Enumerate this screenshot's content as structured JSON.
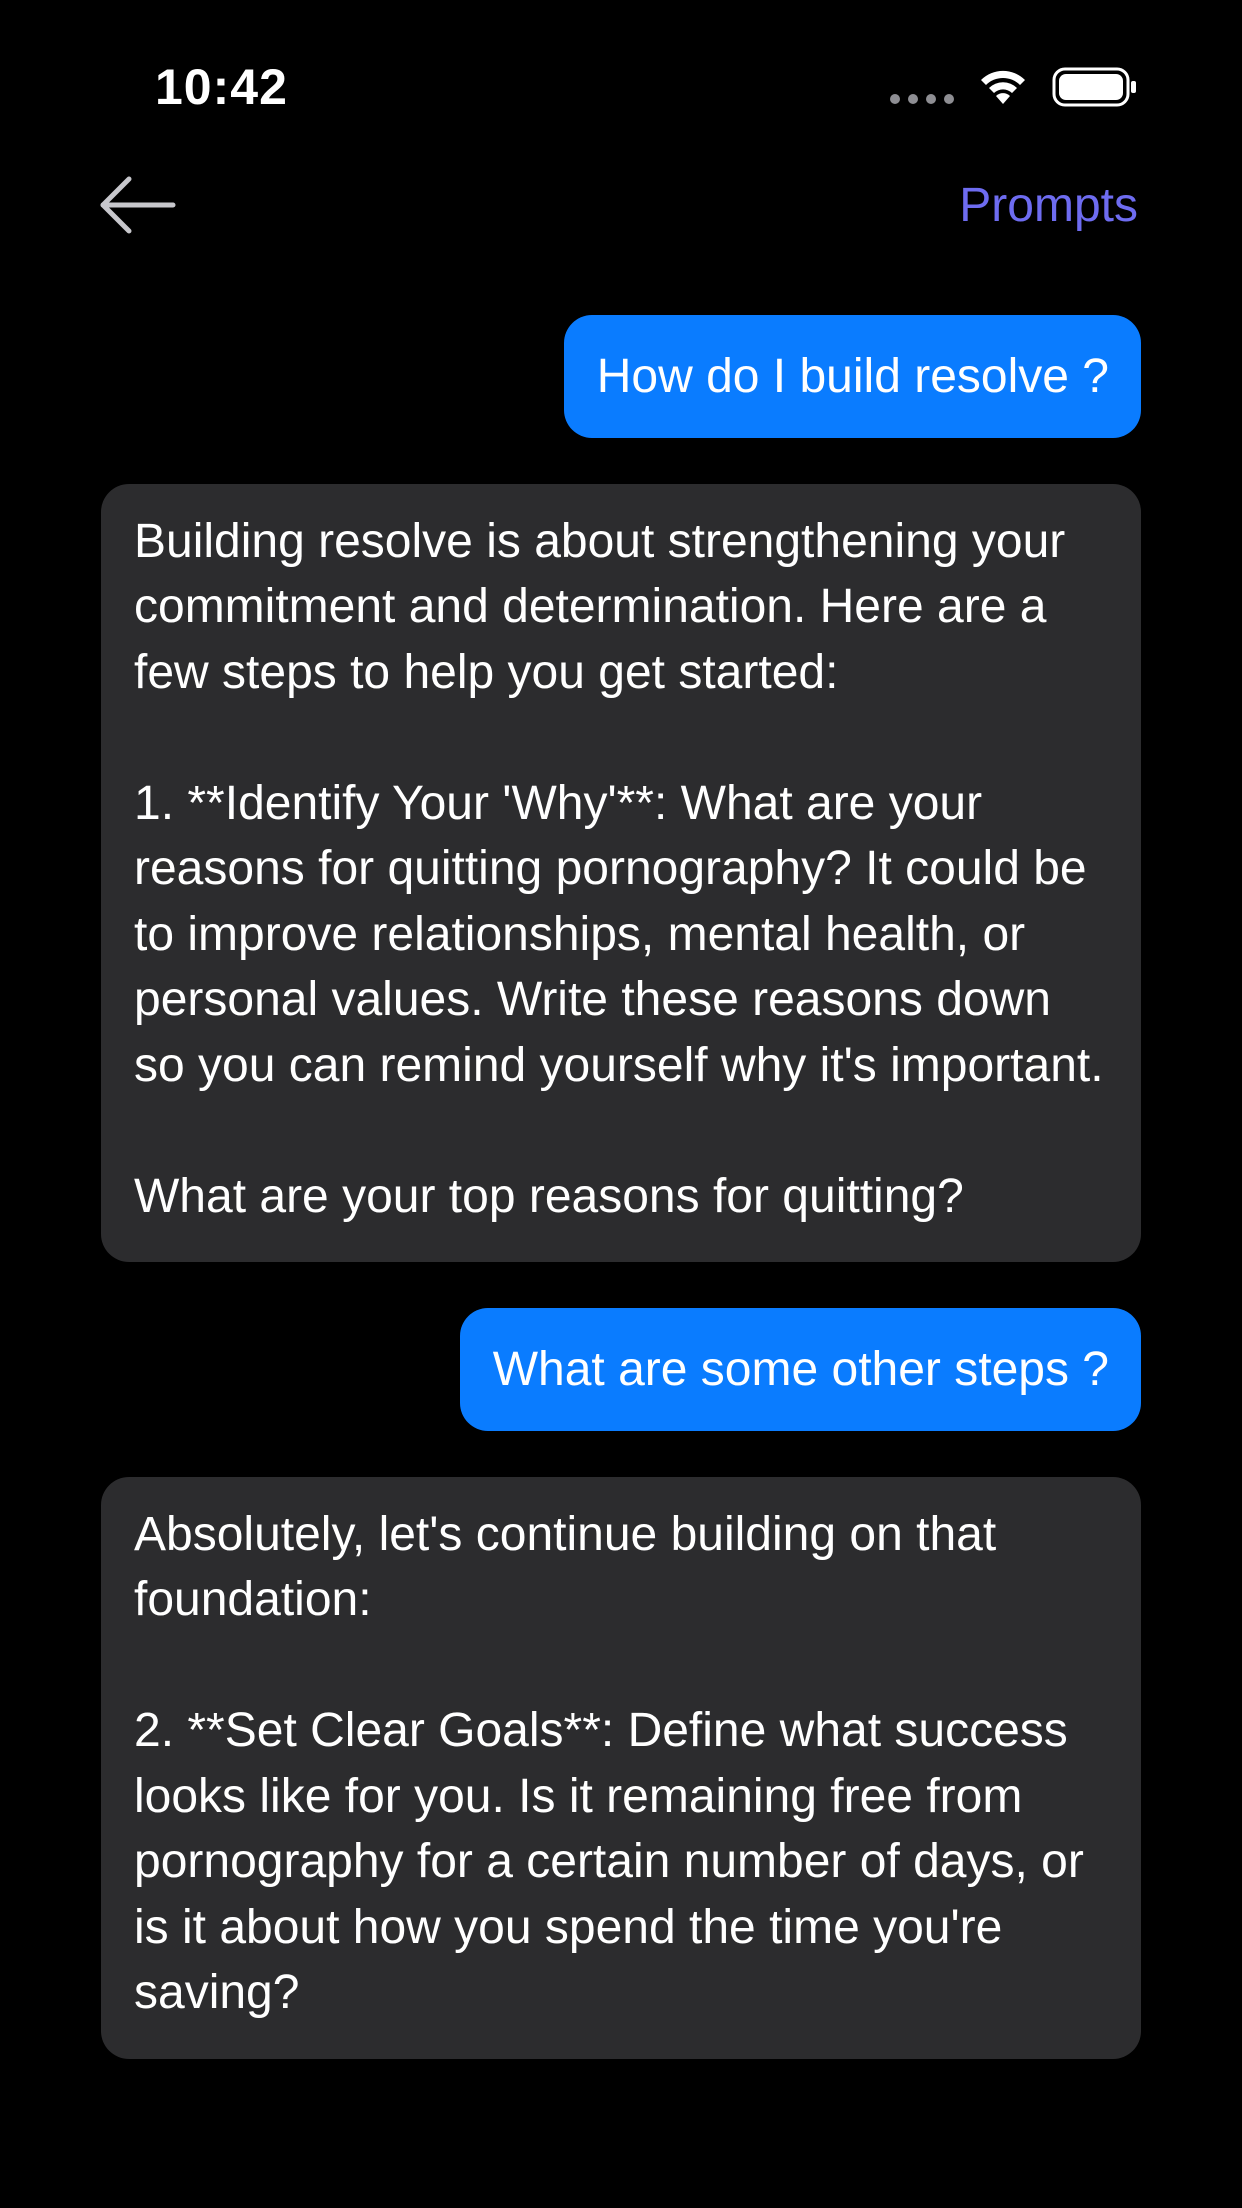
{
  "status_bar": {
    "time": "10:42"
  },
  "nav": {
    "prompts_label": "Prompts"
  },
  "messages": [
    {
      "role": "user",
      "text": "How do I build resolve ?"
    },
    {
      "role": "assistant",
      "text": "Building resolve is about strengthening your commitment and determination. Here are a few steps to help you get started:\n\n1. **Identify Your 'Why'**: What are your reasons for quitting pornography? It could be to improve relationships, mental health, or personal values. Write these reasons down so you can remind yourself why it's important.\n\nWhat are your top reasons for quitting?"
    },
    {
      "role": "user",
      "text": "What are some other steps ?"
    },
    {
      "role": "assistant",
      "text": "Absolutely, let's continue building on that foundation:\n\n2. **Set Clear Goals**: Define what success looks like for you. Is it remaining free from pornography for a certain number of days, or is it about how you spend the time you're saving?"
    }
  ],
  "colors": {
    "background": "#000000",
    "user_bubble": "#0a7cff",
    "assistant_bubble": "#2c2c2e",
    "accent": "#6e6cf0"
  },
  "icons": {
    "back": "arrow-left-icon",
    "signal": "signal-dots-icon",
    "wifi": "wifi-icon",
    "battery": "battery-icon"
  }
}
